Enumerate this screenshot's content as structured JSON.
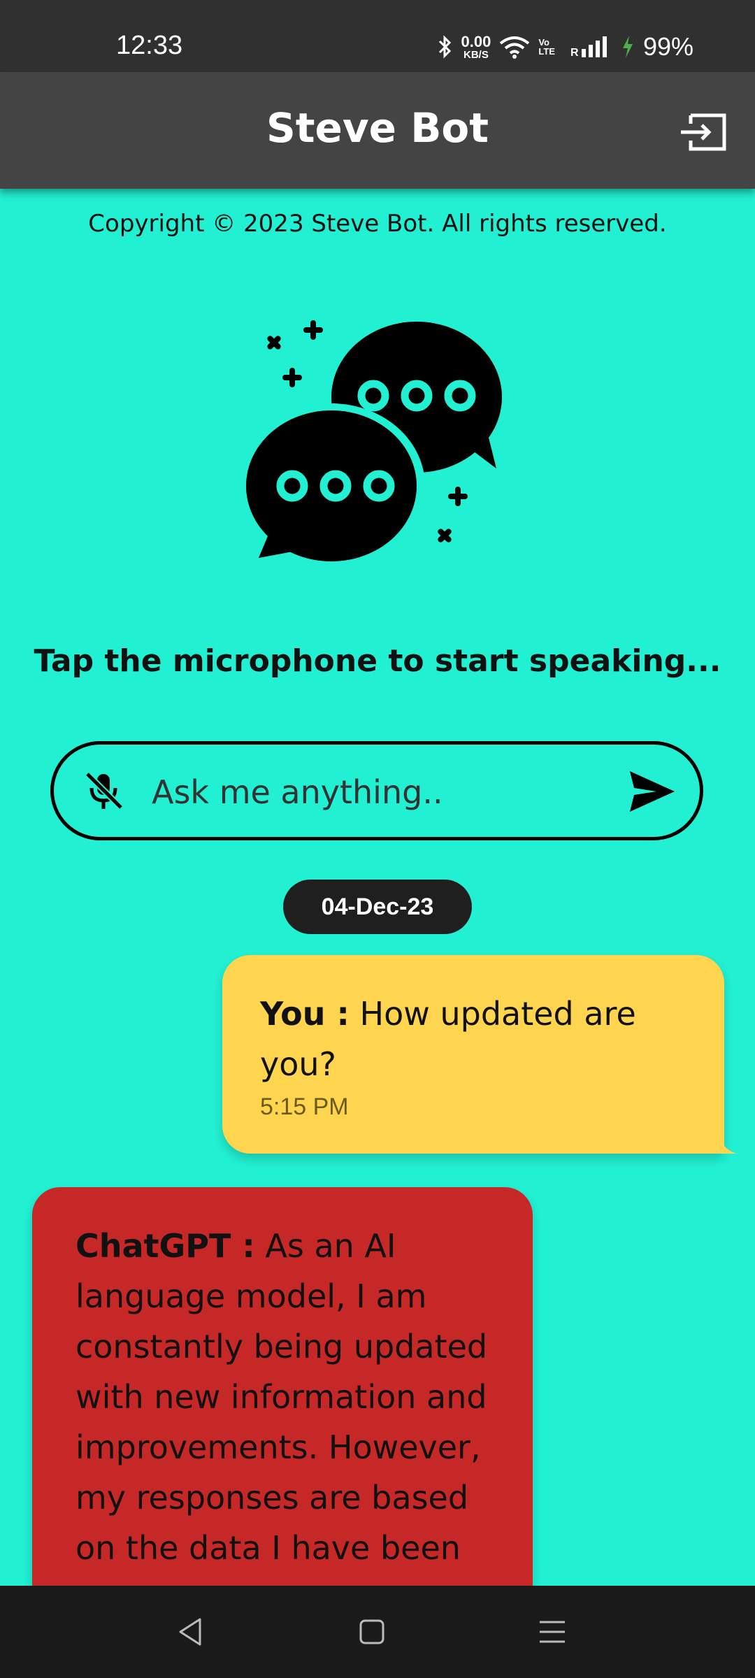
{
  "status_bar": {
    "time": "12:33",
    "net_speed_value": "0.00",
    "net_speed_unit": "KB/S",
    "volte_top": "Vo",
    "volte_bottom": "LTE",
    "roaming": "R",
    "battery": "99%"
  },
  "app_bar": {
    "title": "Steve Bot",
    "exit_icon": "exit-icon"
  },
  "copyright": "Copyright © 2023 Steve Bot. All rights reserved.",
  "hero_icon": "chat-bubbles-icon",
  "hint": "Tap the microphone to start speaking...",
  "input": {
    "placeholder": "Ask me anything..",
    "mic_icon": "mic-off-icon",
    "send_icon": "send-icon"
  },
  "date_chip": "04-Dec-23",
  "messages": [
    {
      "sender": "You :",
      "text": "How updated are you?",
      "time": "5:15 PM"
    },
    {
      "sender": "ChatGPT :",
      "text": "As an AI language model, I am constantly being updated with new information and improvements. However, my responses are based on the data I have been"
    }
  ],
  "colors": {
    "background": "#22f0d2",
    "app_bar": "#444444",
    "user_bubble": "#ffd54f",
    "bot_bubble": "#c62828"
  },
  "nav_bar": {
    "back_icon": "back-icon",
    "home_icon": "home-icon",
    "menu_icon": "menu-icon"
  }
}
